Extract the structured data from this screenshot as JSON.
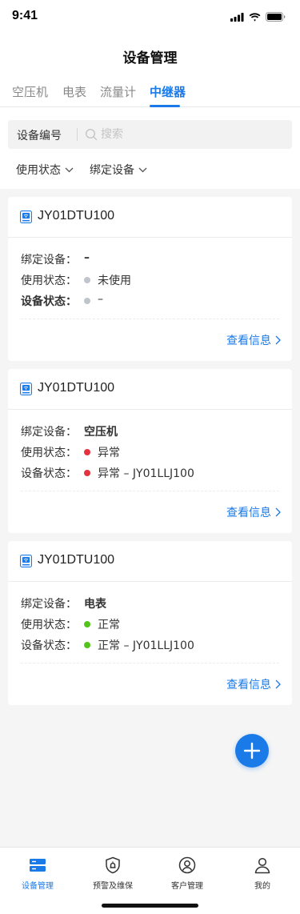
{
  "status_bar": {
    "time": "9:41"
  },
  "header": {
    "title": "设备管理"
  },
  "tabs": [
    {
      "label": "空压机",
      "active": false
    },
    {
      "label": "电表",
      "active": false
    },
    {
      "label": "流量计",
      "active": false
    },
    {
      "label": "中继器",
      "active": true
    }
  ],
  "search": {
    "label": "设备编号",
    "placeholder": "搜索",
    "value": ""
  },
  "filters": [
    {
      "label": "使用状态"
    },
    {
      "label": "绑定设备"
    }
  ],
  "colors": {
    "accent": "#1a7ae8",
    "status_idle": "#c0c4cc",
    "status_error": "#e5323e",
    "status_normal": "#52c41a"
  },
  "cards": [
    {
      "title": "JY01DTU100",
      "bound_label": "绑定设备：",
      "bound_value": "–",
      "usage_label": "使用状态：",
      "usage_value": "未使用",
      "device_label": "设备状态：",
      "device_value": "–",
      "link": "查看信息"
    },
    {
      "title": "JY01DTU100",
      "bound_label": "绑定设备：",
      "bound_value": "空压机",
      "usage_label": "使用状态：",
      "usage_value": "异常",
      "device_label": "设备状态：",
      "device_value": "异常 – JY01LLJ100",
      "link": "查看信息"
    },
    {
      "title": "JY01DTU100",
      "bound_label": "绑定设备：",
      "bound_value": "电表",
      "usage_label": "使用状态：",
      "usage_value": "正常",
      "device_label": "设备状态：",
      "device_value": "正常 – JY01LLJ100",
      "link": "查看信息"
    }
  ],
  "tabbar": [
    {
      "label": "设备管理",
      "icon": "device-management-icon",
      "active": true
    },
    {
      "label": "预警及维保",
      "icon": "alert-shield-icon",
      "active": false
    },
    {
      "label": "客户管理",
      "icon": "customer-icon",
      "active": false
    },
    {
      "label": "我的",
      "icon": "profile-icon",
      "active": false
    }
  ]
}
